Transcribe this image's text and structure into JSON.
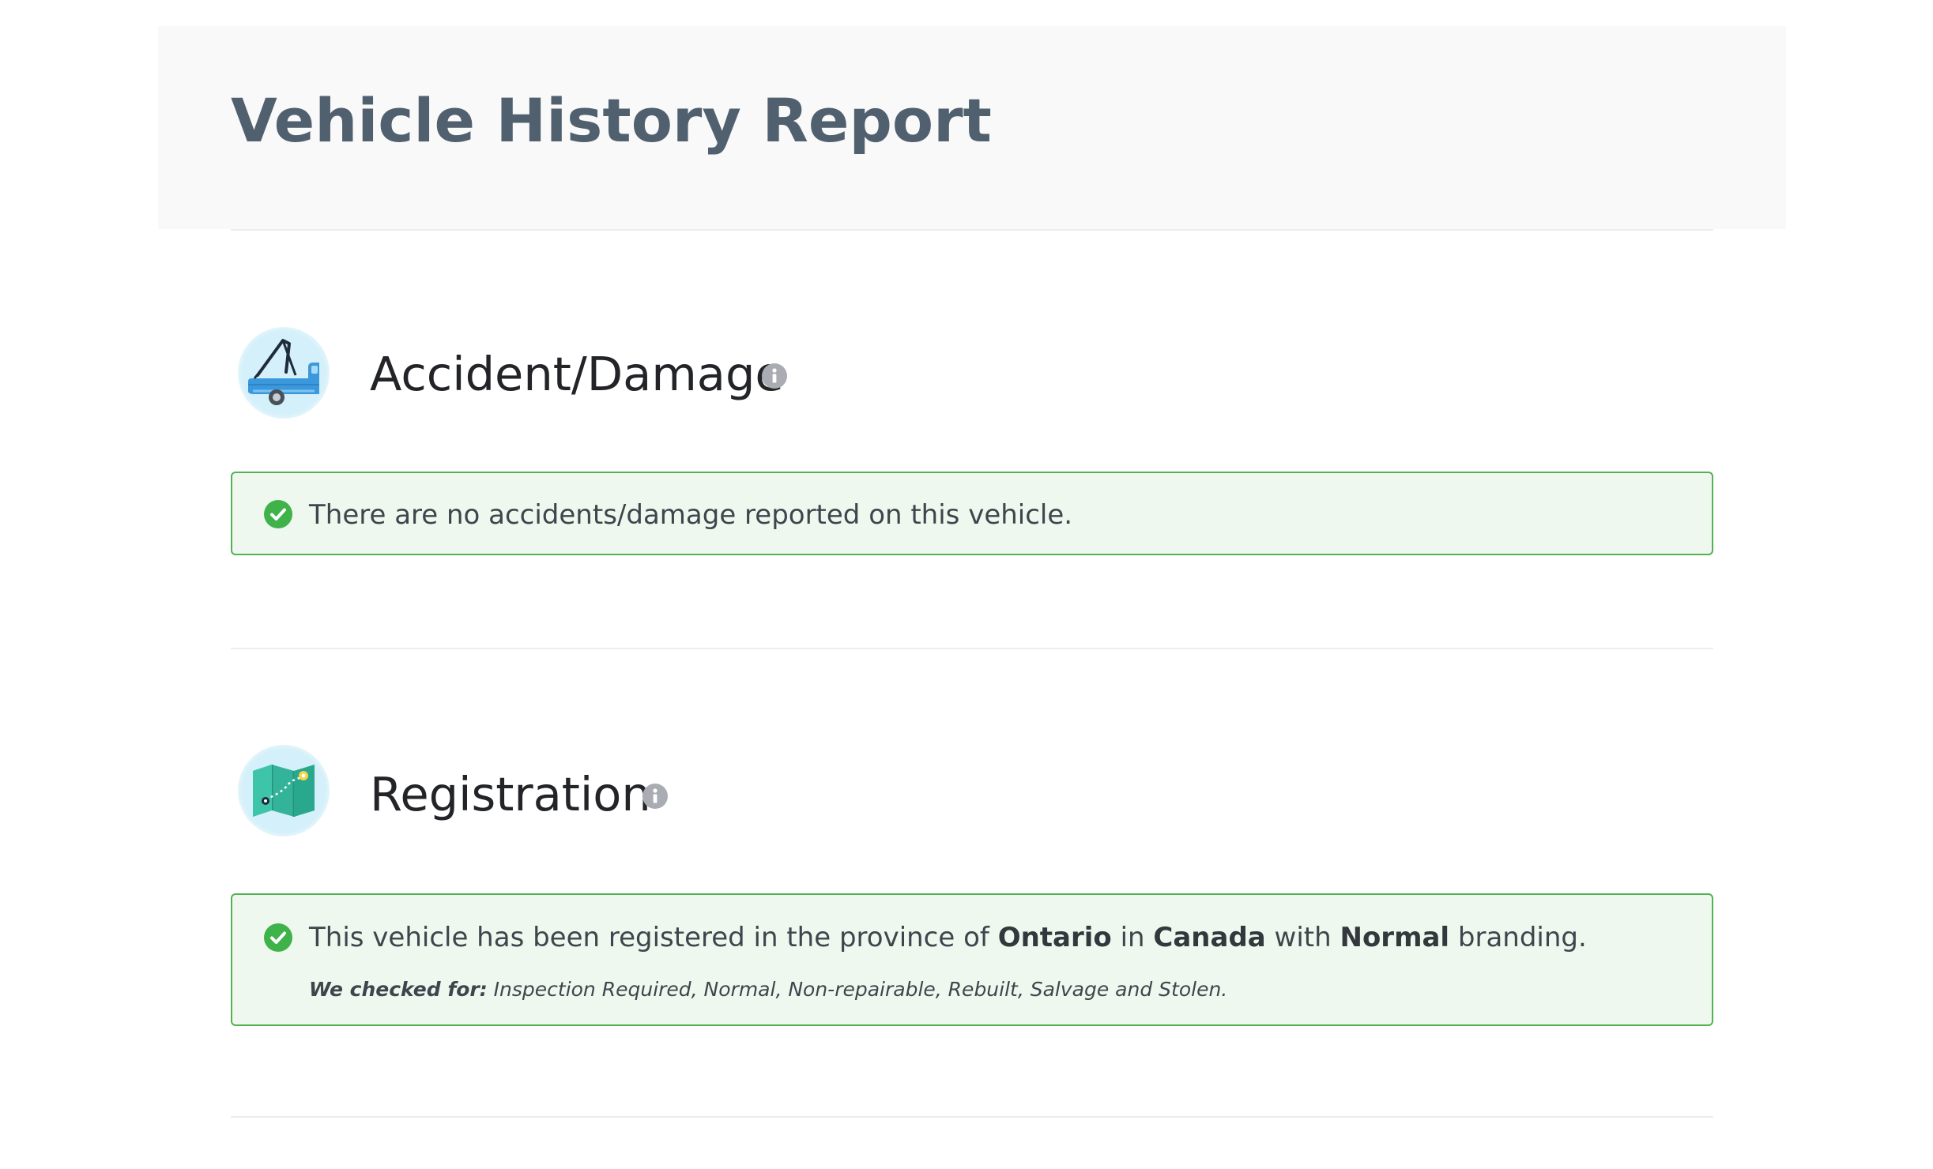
{
  "page": {
    "title": "Vehicle History Report"
  },
  "sections": [
    {
      "title": "Accident/Damage",
      "icon": "tow-truck-icon",
      "message": "There are no accidents/damage reported on this vehicle."
    },
    {
      "title": "Registration",
      "icon": "map-icon",
      "message_parts": {
        "t1": "This vehicle has been registered in the province of ",
        "province": "Ontario",
        "t2": " in ",
        "country": "Canada",
        "t3": " with ",
        "branding": "Normal",
        "t4": " branding."
      },
      "checked_for_label": "We checked for:",
      "checked_for_values": " Inspection Required, Normal, Non-repairable, Rebuilt, Salvage and Stolen."
    }
  ],
  "colors": {
    "title": "#51606f",
    "success_border": "#54b152",
    "success_bg": "#eff8ef",
    "check": "#3fb24a",
    "info_icon": "#a9acb3"
  }
}
